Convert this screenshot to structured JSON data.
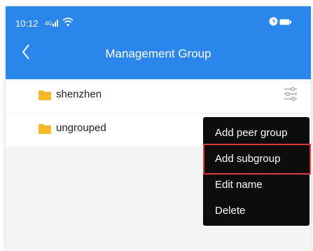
{
  "status_bar": {
    "time": "10:12"
  },
  "header": {
    "title": "Management Group"
  },
  "groups": [
    {
      "name": "shenzhen"
    },
    {
      "name": "ungrouped"
    }
  ],
  "menu": {
    "items": [
      {
        "label": "Add peer group"
      },
      {
        "label": "Add subgroup"
      },
      {
        "label": "Edit name"
      },
      {
        "label": "Delete"
      }
    ]
  },
  "colors": {
    "header_bg": "#2b86ec",
    "folder": "#f6b925",
    "menu_bg": "#0c0c0c",
    "highlight_border": "#e03838"
  },
  "icons": {
    "back": "chevron-left-icon",
    "filter": "settings-sliders-icon",
    "folder": "folder-icon"
  }
}
